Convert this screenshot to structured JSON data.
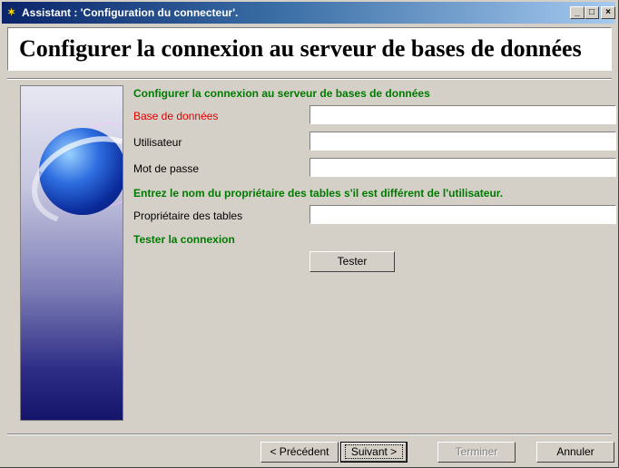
{
  "window": {
    "title": "Assistant : 'Configuration du connecteur'.",
    "minimize_glyph": "_",
    "maximize_glyph": "□",
    "close_glyph": "×"
  },
  "heading": "Configurer la connexion au serveur de bases de données",
  "section1_title": "Configurer la connexion au serveur de bases de données",
  "fields": {
    "database_label": "Base de données",
    "database_value": "",
    "user_label": "Utilisateur",
    "user_value": "",
    "password_label": "Mot de passe",
    "password_value": ""
  },
  "section2_title": "Entrez le nom du propriétaire des tables s'il est différent de l'utilisateur.",
  "owner_label": "Propriétaire des tables",
  "owner_value": "",
  "section3_title": "Tester la connexion",
  "test_button": "Tester",
  "footer": {
    "previous": "< Précédent",
    "next": "Suivant >",
    "finish": "Terminer",
    "cancel": "Annuler"
  },
  "colors": {
    "section_title": "#007a00",
    "required_label": "#e00000",
    "title_bar": "#0a246a"
  },
  "icons": {
    "app_icon": "wizard-icon",
    "side_image": "globe-illustration"
  }
}
